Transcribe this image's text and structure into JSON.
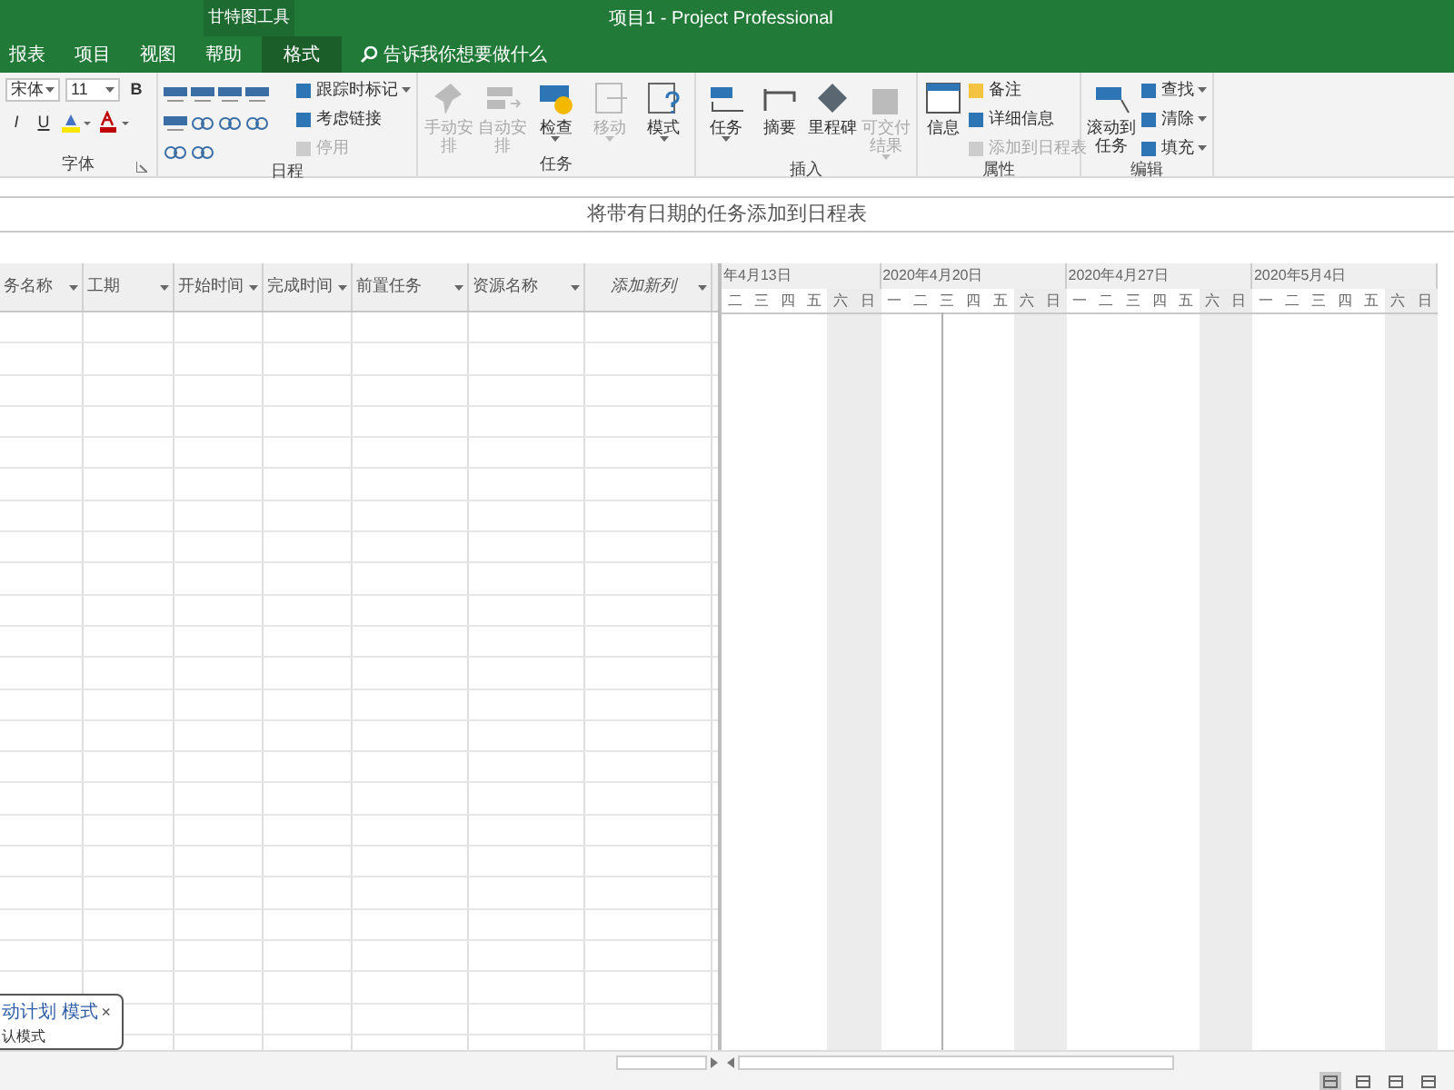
{
  "window": {
    "title": "项目1  -  Project Professional"
  },
  "context_tab_group": "甘特图工具",
  "tabs": [
    {
      "label": "报表",
      "selected": false
    },
    {
      "label": "项目",
      "selected": false
    },
    {
      "label": "视图",
      "selected": false
    },
    {
      "label": "帮助",
      "selected": false
    },
    {
      "label": "格式",
      "selected": true
    }
  ],
  "search": {
    "placeholder": "告诉我你想要做什么"
  },
  "ribbon": [
    {
      "label": "字体",
      "launcher": true,
      "items": [
        {
          "kind": "combo",
          "label": "宋体"
        },
        {
          "kind": "combo",
          "label": "11"
        },
        {
          "kind": "format",
          "label": "B"
        },
        {
          "kind": "format",
          "label": "I"
        },
        {
          "kind": "format",
          "label": "U"
        },
        {
          "kind": "highlight"
        },
        {
          "kind": "fontcolor"
        }
      ]
    },
    {
      "label": "日程",
      "items": [
        {
          "kind": "percent"
        },
        {
          "kind": "percent"
        },
        {
          "kind": "percent"
        },
        {
          "kind": "percent"
        },
        {
          "kind": "percent"
        },
        {
          "kind": "link"
        },
        {
          "kind": "link"
        },
        {
          "kind": "link"
        },
        {
          "kind": "link"
        },
        {
          "kind": "link"
        },
        {
          "kind": "small",
          "label": "跟踪时标记",
          "disabled": false,
          "dropdown": true
        },
        {
          "kind": "small",
          "label": "考虑链接",
          "disabled": false,
          "dropdown": false
        },
        {
          "kind": "small",
          "label": "停用",
          "disabled": true,
          "dropdown": false
        }
      ]
    },
    {
      "label": "任务",
      "items": [
        {
          "kind": "large",
          "label": "手动安排",
          "disabled": true,
          "dropdown": false
        },
        {
          "kind": "large",
          "label": "自动安排",
          "disabled": true,
          "dropdown": false
        },
        {
          "kind": "large",
          "label": "检查",
          "disabled": false,
          "dropdown": true
        },
        {
          "kind": "large",
          "label": "移动",
          "disabled": true,
          "dropdown": true
        },
        {
          "kind": "large",
          "label": "模式",
          "disabled": false,
          "dropdown": true
        }
      ]
    },
    {
      "label": "插入",
      "items": [
        {
          "kind": "large",
          "label": "任务",
          "disabled": false,
          "dropdown": true
        },
        {
          "kind": "large",
          "label": "摘要",
          "disabled": false,
          "dropdown": false
        },
        {
          "kind": "large",
          "label": "里程碑",
          "disabled": false,
          "dropdown": false
        },
        {
          "kind": "large",
          "label": "可交付结果",
          "disabled": true,
          "dropdown": true
        }
      ]
    },
    {
      "label": "属性",
      "items": [
        {
          "kind": "large",
          "label": "信息",
          "disabled": false,
          "dropdown": false
        },
        {
          "kind": "small",
          "label": "备注",
          "disabled": false,
          "dropdown": false
        },
        {
          "kind": "small",
          "label": "详细信息",
          "disabled": false,
          "dropdown": false
        },
        {
          "kind": "small",
          "label": "添加到日程表",
          "disabled": true,
          "dropdown": false
        }
      ]
    },
    {
      "label": "编辑",
      "items": [
        {
          "kind": "large",
          "label": "滚动到任务",
          "disabled": false,
          "dropdown": false
        },
        {
          "kind": "small",
          "label": "查找",
          "disabled": false,
          "dropdown": true
        },
        {
          "kind": "small",
          "label": "清除",
          "disabled": false,
          "dropdown": true
        },
        {
          "kind": "small",
          "label": "填充",
          "disabled": false,
          "dropdown": true
        }
      ]
    }
  ],
  "timeline": {
    "placeholder": "将带有日期的任务添加到日程表"
  },
  "table": {
    "columns": [
      {
        "label": "务名称",
        "italic": false
      },
      {
        "label": "工期",
        "italic": false
      },
      {
        "label": "开始时间",
        "italic": false
      },
      {
        "label": "完成时间",
        "italic": false
      },
      {
        "label": "前置任务",
        "italic": false
      },
      {
        "label": "资源名称",
        "italic": false
      },
      {
        "label": "添加新列",
        "italic": true
      }
    ]
  },
  "gantt": {
    "weeks": [
      {
        "label": "年4月13日",
        "days": [
          {
            "label": "二",
            "weekend": false
          },
          {
            "label": "三",
            "weekend": false
          },
          {
            "label": "四",
            "weekend": false
          },
          {
            "label": "五",
            "weekend": false
          },
          {
            "label": "六",
            "weekend": true
          },
          {
            "label": "日",
            "weekend": true
          }
        ]
      },
      {
        "label": "2020年4月20日",
        "days": [
          {
            "label": "一",
            "weekend": false
          },
          {
            "label": "二",
            "weekend": false
          },
          {
            "label": "三",
            "weekend": false
          },
          {
            "label": "四",
            "weekend": false
          },
          {
            "label": "五",
            "weekend": false
          },
          {
            "label": "六",
            "weekend": true
          },
          {
            "label": "日",
            "weekend": true
          }
        ]
      },
      {
        "label": "2020年4月27日",
        "days": [
          {
            "label": "一",
            "weekend": false
          },
          {
            "label": "二",
            "weekend": false
          },
          {
            "label": "三",
            "weekend": false
          },
          {
            "label": "四",
            "weekend": false
          },
          {
            "label": "五",
            "weekend": false
          },
          {
            "label": "六",
            "weekend": true
          },
          {
            "label": "日",
            "weekend": true
          }
        ]
      },
      {
        "label": "2020年5月4日",
        "days": [
          {
            "label": "一",
            "weekend": false
          },
          {
            "label": "二",
            "weekend": false
          },
          {
            "label": "三",
            "weekend": false
          },
          {
            "label": "四",
            "weekend": false
          },
          {
            "label": "五",
            "weekend": false
          },
          {
            "label": "六",
            "weekend": true
          },
          {
            "label": "日",
            "weekend": true
          }
        ]
      }
    ]
  },
  "popup": {
    "title": "动计划 模式",
    "close": "×",
    "text": "认模式"
  },
  "status_bar": {
    "views": [
      {
        "selected": true
      },
      {
        "selected": false
      },
      {
        "selected": false
      },
      {
        "selected": false
      }
    ]
  }
}
